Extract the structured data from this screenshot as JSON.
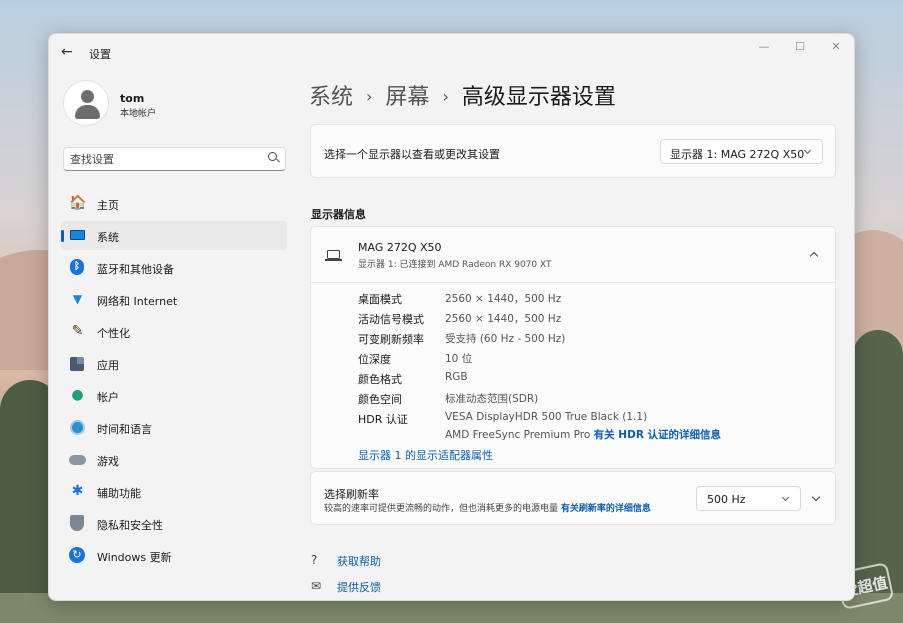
{
  "window": {
    "title": "设置",
    "back_glyph": "←",
    "min_glyph": "—",
    "max_glyph": "☐",
    "close_glyph": "✕"
  },
  "user": {
    "name": "tom",
    "account_type": "本地帐户"
  },
  "search": {
    "placeholder": "查找设置"
  },
  "sidebar": {
    "items": [
      {
        "label": "主页",
        "icon": "home-icon",
        "glyph": "🏠",
        "active": false
      },
      {
        "label": "系统",
        "icon": "system-icon",
        "glyph": "",
        "active": true
      },
      {
        "label": "蓝牙和其他设备",
        "icon": "bluetooth-icon",
        "glyph": "ᛒ",
        "active": false
      },
      {
        "label": "网络和 Internet",
        "icon": "wifi-icon",
        "glyph": "▼",
        "active": false
      },
      {
        "label": "个性化",
        "icon": "brush-icon",
        "glyph": "✎",
        "active": false
      },
      {
        "label": "应用",
        "icon": "apps-icon",
        "glyph": "",
        "active": false
      },
      {
        "label": "帐户",
        "icon": "account-icon",
        "glyph": "●",
        "active": false
      },
      {
        "label": "时间和语言",
        "icon": "clock-globe-icon",
        "glyph": "",
        "active": false
      },
      {
        "label": "游戏",
        "icon": "gamepad-icon",
        "glyph": "",
        "active": false
      },
      {
        "label": "辅助功能",
        "icon": "accessibility-icon",
        "glyph": "✱",
        "active": false
      },
      {
        "label": "隐私和安全性",
        "icon": "shield-icon",
        "glyph": "",
        "active": false
      },
      {
        "label": "Windows 更新",
        "icon": "update-icon",
        "glyph": "↻",
        "active": false
      }
    ]
  },
  "breadcrumb": {
    "level1": "系统",
    "level2": "屏幕",
    "current": "高级显示器设置",
    "sep": "›"
  },
  "select_display": {
    "label": "选择一个显示器以查看或更改其设置",
    "selected": "显示器 1: MAG 272Q X50"
  },
  "display_info": {
    "section_title": "显示器信息",
    "monitor_name": "MAG 272Q X50",
    "monitor_subtitle": "显示器 1: 已连接到 AMD Radeon RX 9070 XT",
    "rows": [
      {
        "key": "桌面模式",
        "value": "2560 × 1440，500 Hz"
      },
      {
        "key": "活动信号模式",
        "value": "2560 × 1440，500 Hz"
      },
      {
        "key": "可变刷新频率",
        "value": "受支持 (60 Hz - 500 Hz)"
      },
      {
        "key": "位深度",
        "value": "10 位"
      },
      {
        "key": "颜色格式",
        "value": "RGB"
      },
      {
        "key": "颜色空间",
        "value": "标准动态范围(SDR)"
      }
    ],
    "hdr": {
      "key": "HDR 认证",
      "line1": "VESA DisplayHDR 500 True Black (1.1)",
      "line2": "AMD FreeSync Premium Pro",
      "link": "有关 HDR 认证的详细信息"
    },
    "adapter_link": "显示器 1 的显示适配器属性"
  },
  "refresh_rate": {
    "title": "选择刷新率",
    "description": "较高的速率可提供更流畅的动作，但也消耗更多的电源电量",
    "link": "有关刷新率的详细信息",
    "selected": "500 Hz"
  },
  "footer": {
    "help": "获取帮助",
    "feedback": "提供反馈"
  },
  "watermark": "爱超值"
}
